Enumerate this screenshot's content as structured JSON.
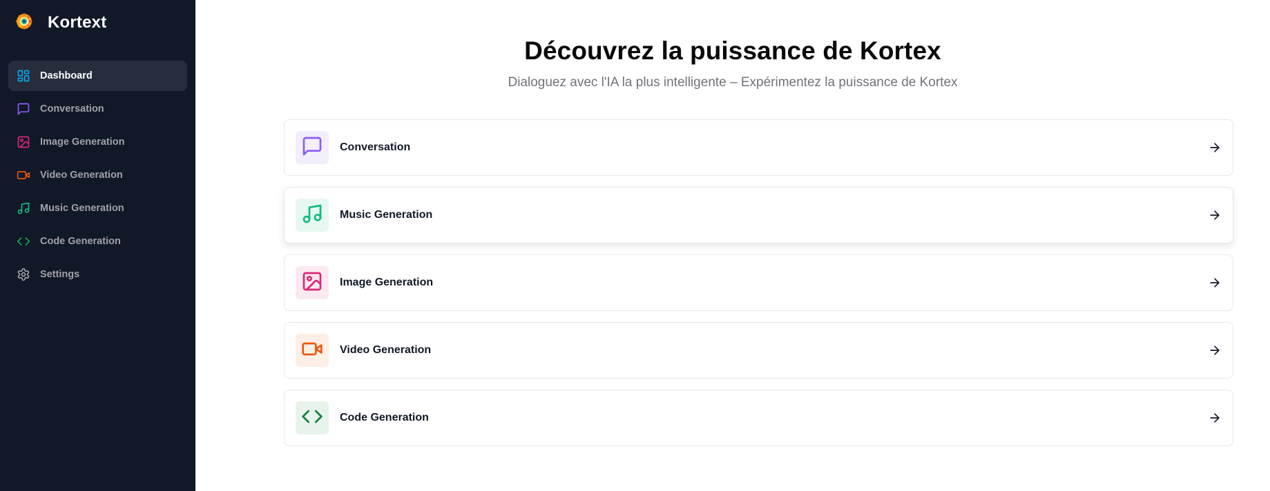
{
  "brand": {
    "name": "Kortext"
  },
  "sidebar": {
    "items": [
      {
        "label": "Dashboard",
        "icon": "dashboard-icon",
        "color": "#0ea5e9",
        "active": true
      },
      {
        "label": "Conversation",
        "icon": "message-square-icon",
        "color": "#8b5cf6",
        "active": false
      },
      {
        "label": "Image Generation",
        "icon": "image-icon",
        "color": "#db2777",
        "active": false
      },
      {
        "label": "Video Generation",
        "icon": "video-icon",
        "color": "#ea580c",
        "active": false
      },
      {
        "label": "Music Generation",
        "icon": "music-icon",
        "color": "#10b981",
        "active": false
      },
      {
        "label": "Code Generation",
        "icon": "code-icon",
        "color": "#16a34a",
        "active": false
      },
      {
        "label": "Settings",
        "icon": "settings-icon",
        "color": "#a1a1aa",
        "active": false
      }
    ]
  },
  "hero": {
    "title": "Découvrez la puissance de Kortex",
    "subtitle": "Dialoguez avec l'IA la plus intelligente – Expérimentez la puissance de Kortex"
  },
  "tools": [
    {
      "label": "Conversation",
      "icon": "message-square-icon",
      "color": "#8b5cf6",
      "bg": "#f3eefe"
    },
    {
      "label": "Music Generation",
      "icon": "music-icon",
      "color": "#10b981",
      "bg": "#e7f8f1"
    },
    {
      "label": "Image Generation",
      "icon": "image-icon",
      "color": "#db2777",
      "bg": "#fbe9f1"
    },
    {
      "label": "Video Generation",
      "icon": "video-icon",
      "color": "#ea580c",
      "bg": "#fdefe6"
    },
    {
      "label": "Code Generation",
      "icon": "code-icon",
      "color": "#15803d",
      "bg": "#e8f3ec"
    }
  ],
  "colors": {
    "sidebar_bg": "#111827",
    "active_item_bg": "#262e3d"
  }
}
